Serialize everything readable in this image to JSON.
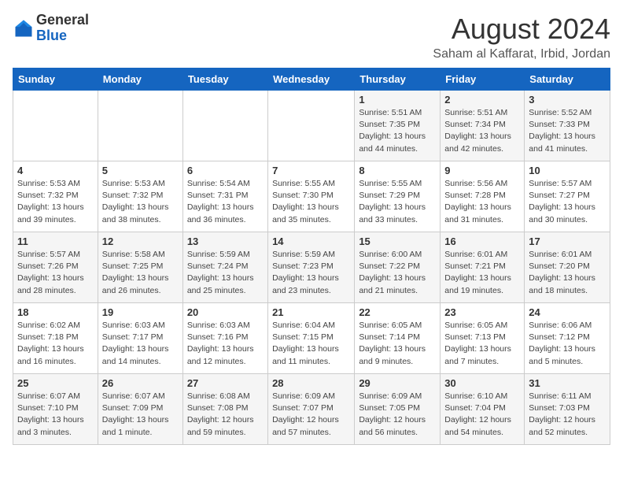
{
  "header": {
    "logo_general": "General",
    "logo_blue": "Blue",
    "month": "August 2024",
    "location": "Saham al Kaffarat, Irbid, Jordan"
  },
  "days_of_week": [
    "Sunday",
    "Monday",
    "Tuesday",
    "Wednesday",
    "Thursday",
    "Friday",
    "Saturday"
  ],
  "weeks": [
    [
      {
        "day": "",
        "info": ""
      },
      {
        "day": "",
        "info": ""
      },
      {
        "day": "",
        "info": ""
      },
      {
        "day": "",
        "info": ""
      },
      {
        "day": "1",
        "info": "Sunrise: 5:51 AM\nSunset: 7:35 PM\nDaylight: 13 hours\nand 44 minutes."
      },
      {
        "day": "2",
        "info": "Sunrise: 5:51 AM\nSunset: 7:34 PM\nDaylight: 13 hours\nand 42 minutes."
      },
      {
        "day": "3",
        "info": "Sunrise: 5:52 AM\nSunset: 7:33 PM\nDaylight: 13 hours\nand 41 minutes."
      }
    ],
    [
      {
        "day": "4",
        "info": "Sunrise: 5:53 AM\nSunset: 7:32 PM\nDaylight: 13 hours\nand 39 minutes."
      },
      {
        "day": "5",
        "info": "Sunrise: 5:53 AM\nSunset: 7:32 PM\nDaylight: 13 hours\nand 38 minutes."
      },
      {
        "day": "6",
        "info": "Sunrise: 5:54 AM\nSunset: 7:31 PM\nDaylight: 13 hours\nand 36 minutes."
      },
      {
        "day": "7",
        "info": "Sunrise: 5:55 AM\nSunset: 7:30 PM\nDaylight: 13 hours\nand 35 minutes."
      },
      {
        "day": "8",
        "info": "Sunrise: 5:55 AM\nSunset: 7:29 PM\nDaylight: 13 hours\nand 33 minutes."
      },
      {
        "day": "9",
        "info": "Sunrise: 5:56 AM\nSunset: 7:28 PM\nDaylight: 13 hours\nand 31 minutes."
      },
      {
        "day": "10",
        "info": "Sunrise: 5:57 AM\nSunset: 7:27 PM\nDaylight: 13 hours\nand 30 minutes."
      }
    ],
    [
      {
        "day": "11",
        "info": "Sunrise: 5:57 AM\nSunset: 7:26 PM\nDaylight: 13 hours\nand 28 minutes."
      },
      {
        "day": "12",
        "info": "Sunrise: 5:58 AM\nSunset: 7:25 PM\nDaylight: 13 hours\nand 26 minutes."
      },
      {
        "day": "13",
        "info": "Sunrise: 5:59 AM\nSunset: 7:24 PM\nDaylight: 13 hours\nand 25 minutes."
      },
      {
        "day": "14",
        "info": "Sunrise: 5:59 AM\nSunset: 7:23 PM\nDaylight: 13 hours\nand 23 minutes."
      },
      {
        "day": "15",
        "info": "Sunrise: 6:00 AM\nSunset: 7:22 PM\nDaylight: 13 hours\nand 21 minutes."
      },
      {
        "day": "16",
        "info": "Sunrise: 6:01 AM\nSunset: 7:21 PM\nDaylight: 13 hours\nand 19 minutes."
      },
      {
        "day": "17",
        "info": "Sunrise: 6:01 AM\nSunset: 7:20 PM\nDaylight: 13 hours\nand 18 minutes."
      }
    ],
    [
      {
        "day": "18",
        "info": "Sunrise: 6:02 AM\nSunset: 7:18 PM\nDaylight: 13 hours\nand 16 minutes."
      },
      {
        "day": "19",
        "info": "Sunrise: 6:03 AM\nSunset: 7:17 PM\nDaylight: 13 hours\nand 14 minutes."
      },
      {
        "day": "20",
        "info": "Sunrise: 6:03 AM\nSunset: 7:16 PM\nDaylight: 13 hours\nand 12 minutes."
      },
      {
        "day": "21",
        "info": "Sunrise: 6:04 AM\nSunset: 7:15 PM\nDaylight: 13 hours\nand 11 minutes."
      },
      {
        "day": "22",
        "info": "Sunrise: 6:05 AM\nSunset: 7:14 PM\nDaylight: 13 hours\nand 9 minutes."
      },
      {
        "day": "23",
        "info": "Sunrise: 6:05 AM\nSunset: 7:13 PM\nDaylight: 13 hours\nand 7 minutes."
      },
      {
        "day": "24",
        "info": "Sunrise: 6:06 AM\nSunset: 7:12 PM\nDaylight: 13 hours\nand 5 minutes."
      }
    ],
    [
      {
        "day": "25",
        "info": "Sunrise: 6:07 AM\nSunset: 7:10 PM\nDaylight: 13 hours\nand 3 minutes."
      },
      {
        "day": "26",
        "info": "Sunrise: 6:07 AM\nSunset: 7:09 PM\nDaylight: 13 hours\nand 1 minute."
      },
      {
        "day": "27",
        "info": "Sunrise: 6:08 AM\nSunset: 7:08 PM\nDaylight: 12 hours\nand 59 minutes."
      },
      {
        "day": "28",
        "info": "Sunrise: 6:09 AM\nSunset: 7:07 PM\nDaylight: 12 hours\nand 57 minutes."
      },
      {
        "day": "29",
        "info": "Sunrise: 6:09 AM\nSunset: 7:05 PM\nDaylight: 12 hours\nand 56 minutes."
      },
      {
        "day": "30",
        "info": "Sunrise: 6:10 AM\nSunset: 7:04 PM\nDaylight: 12 hours\nand 54 minutes."
      },
      {
        "day": "31",
        "info": "Sunrise: 6:11 AM\nSunset: 7:03 PM\nDaylight: 12 hours\nand 52 minutes."
      }
    ]
  ]
}
